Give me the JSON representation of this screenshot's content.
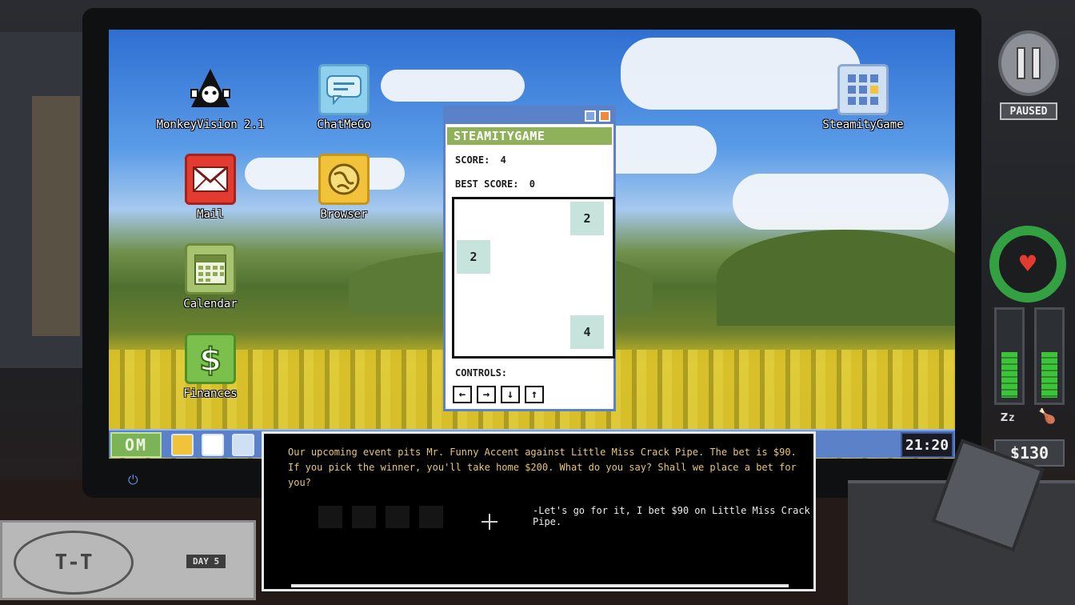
{
  "desktop": {
    "icons": [
      {
        "label": "MonkeyVision 2.1",
        "icon": "monkey-icon"
      },
      {
        "label": "ChatMeGo",
        "icon": "chat-bubble-icon"
      },
      {
        "label": "Mail",
        "icon": "envelope-icon"
      },
      {
        "label": "Browser",
        "icon": "globe-icon"
      },
      {
        "label": "Calendar",
        "icon": "calendar-icon"
      },
      {
        "label": "Finances",
        "icon": "dollar-icon"
      },
      {
        "label": "SteamityGame",
        "icon": "grid-game-icon"
      }
    ]
  },
  "taskbar": {
    "start_label": "OM",
    "clock": "21:20"
  },
  "game_window": {
    "title": "STEAMITYGAME",
    "score_label": "SCORE:",
    "score_value": "4",
    "best_label": "BEST SCORE:",
    "best_value": "0",
    "tiles": [
      "2",
      "2",
      "4"
    ],
    "controls_label": "CONTROLS:",
    "controls": [
      "←",
      "→",
      "↓",
      "↑"
    ]
  },
  "dialog": {
    "message": "Our upcoming event pits Mr. Funny Accent against Little Miss Crack Pipe. The bet is $90. If you pick the winner, you'll take home $200. What do you say? Shall we place a bet for you?",
    "choice": "-Let's go for it, I bet $90 on Little Miss Crack Pipe."
  },
  "hud": {
    "paused_label": "PAUSED",
    "money": "$130",
    "sleep_icon": "zzz-icon",
    "hunger_icon": "drumstick-icon",
    "heart_icon": "heart-icon",
    "sleep_level": 0.55,
    "hunger_level": 0.55
  },
  "desk": {
    "logo_text": "T-T",
    "day_label": "DAY 5"
  },
  "colors": {
    "taskbar": "#5b82c8",
    "game_title_bar": "#8fb15a",
    "tile": "#c6e4dc",
    "dialog_text": "#e8c670",
    "health": "#33a042"
  }
}
